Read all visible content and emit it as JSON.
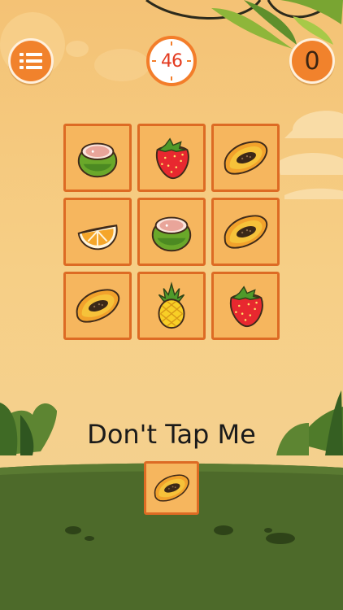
{
  "hud": {
    "menu_icon": "list-menu-icon",
    "timer_value": "46",
    "score_value": "0"
  },
  "board": {
    "tiles": [
      {
        "fruit": "coconut"
      },
      {
        "fruit": "strawberry"
      },
      {
        "fruit": "papaya"
      },
      {
        "fruit": "orange-slice"
      },
      {
        "fruit": "coconut"
      },
      {
        "fruit": "papaya"
      },
      {
        "fruit": "papaya"
      },
      {
        "fruit": "pineapple"
      },
      {
        "fruit": "strawberry"
      }
    ]
  },
  "caption": "Don't Tap Me",
  "forbidden_tile": {
    "fruit": "papaya"
  },
  "colors": {
    "accent": "#f1822c",
    "tile_fill": "#f6b65e",
    "tile_border": "#dd6b24",
    "timer_text": "#e33a1f",
    "grass": "#4d6a2a"
  }
}
